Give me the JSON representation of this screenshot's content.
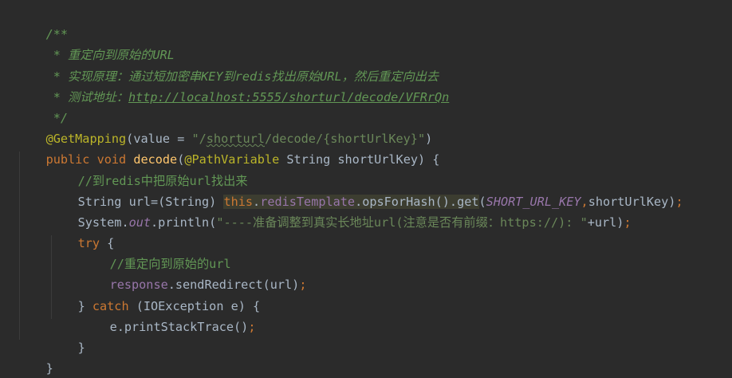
{
  "editor": {
    "theme_colors": {
      "background": "#2b2b2b",
      "default_text": "#a9b7c6",
      "keyword": "#cc7832",
      "string": "#6a8759",
      "comment": "#629755",
      "annotation": "#bbb529",
      "method_decl": "#ffc66d",
      "field": "#9876aa"
    },
    "lines": {
      "l1": {
        "doc_open": "/**"
      },
      "l2": {
        "star": " * ",
        "text": "重定向到原始的URL"
      },
      "l3": {
        "star": " * ",
        "text": "实现原理：通过短加密串KEY到redis找出原始URL，然后重定向出去"
      },
      "l4": {
        "star": " * ",
        "label": "测试地址：",
        "link": "http://localhost:5555/shorturl/decode/VFRrQn"
      },
      "l5": {
        "doc_close": " */"
      },
      "l6": {
        "annotation": "@GetMapping",
        "open_paren": "(",
        "param": "value = ",
        "str_a": "\"/",
        "str_squig": "shorturl",
        "str_b": "/decode/{shortUrlKey}\"",
        "close_paren": ")"
      },
      "l7": {
        "kw_public": "public",
        "kw_void": "void",
        "method": "decode",
        "paren_open": "(",
        "annotation": "@PathVariable",
        "rest": " String shortUrlKey) {"
      },
      "l8": {
        "comment": "//到redis中把原始url找出来"
      },
      "l9": {
        "start": "String url=(String) ",
        "kw_this": "this",
        "dot": ".",
        "field": "redisTemplate",
        "call": ".opsForHash().get",
        "paren": "(",
        "const": "SHORT_URL_KEY",
        "comma": ",",
        "args_end": "shortUrlKey)",
        "semi": ";"
      },
      "l10": {
        "start": "System.",
        "static_field": "out",
        "call": ".println(",
        "str": "\"----准备调整到真实长地址url(注意是否有前缀：https://): \"",
        "rest": "+url)",
        "semi": ";"
      },
      "l11": {
        "kw_try": "try",
        "rest": " {"
      },
      "l12": {
        "comment": "//重定向到原始的url"
      },
      "l13": {
        "field": "response",
        "call": ".sendRedirect(url)",
        "semi": ";"
      },
      "l14": {
        "start": "} ",
        "kw_catch": "catch",
        "rest": " (IOException e) {"
      },
      "l15": {
        "call": "e.printStackTrace()",
        "semi": ";"
      },
      "l16": {
        "brace": "}"
      },
      "l17": {
        "brace": "}"
      }
    }
  }
}
